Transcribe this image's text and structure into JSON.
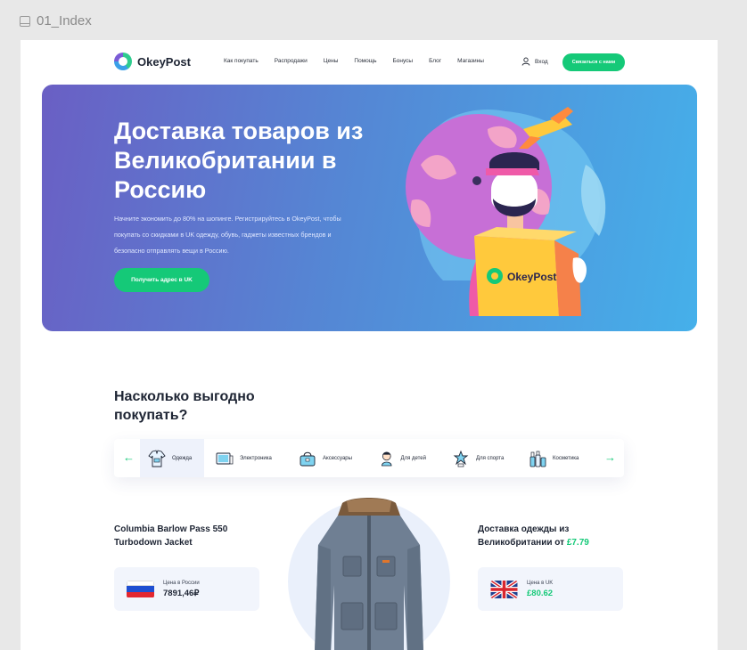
{
  "frame": {
    "label": "01_Index"
  },
  "nav": {
    "brand": "OkeyPost",
    "menu": [
      "Как покупать",
      "Распродажи",
      "Цены",
      "Помощь",
      "Бонусы",
      "Блог",
      "Магазины"
    ],
    "login_label": "Вход",
    "contact_button": "Связаться с нами"
  },
  "hero": {
    "title": "Доставка товаров из Великобритании в Россию",
    "description": "Начните экономить до 80% на шопинге. Регистрируйтесь в OkeyPost, чтобы покупать со скидками в UK одежду, обувь, гаджеты известных брендов и безопасно отправлять вещи в Россию.",
    "button": "Получить адрес в UK",
    "box_brand": "OkeyPost"
  },
  "savings": {
    "title": "Насколько выгодно покупать?",
    "categories": [
      {
        "label": "Одежда",
        "icon": "clothes-icon"
      },
      {
        "label": "Электроника",
        "icon": "electronics-icon"
      },
      {
        "label": "Аксессуары",
        "icon": "bag-icon"
      },
      {
        "label": "Для детей",
        "icon": "kids-icon"
      },
      {
        "label": "Для спорта",
        "icon": "sport-icon"
      },
      {
        "label": "Косметика",
        "icon": "cosmetics-icon"
      }
    ],
    "product_name": "Columbia Barlow Pass 550 Turbodown Jacket",
    "russia_price_label": "Цена в России",
    "russia_price": "7891,46₽",
    "shipping_text": "Доставка одежды из Великобритании  от",
    "shipping_price": "£7.79",
    "uk_price_label": "Цена в UK",
    "uk_price": "£80.62"
  },
  "colors": {
    "accent": "#15c978",
    "hero_start": "#6a5fc4",
    "hero_end": "#45b0ea"
  }
}
